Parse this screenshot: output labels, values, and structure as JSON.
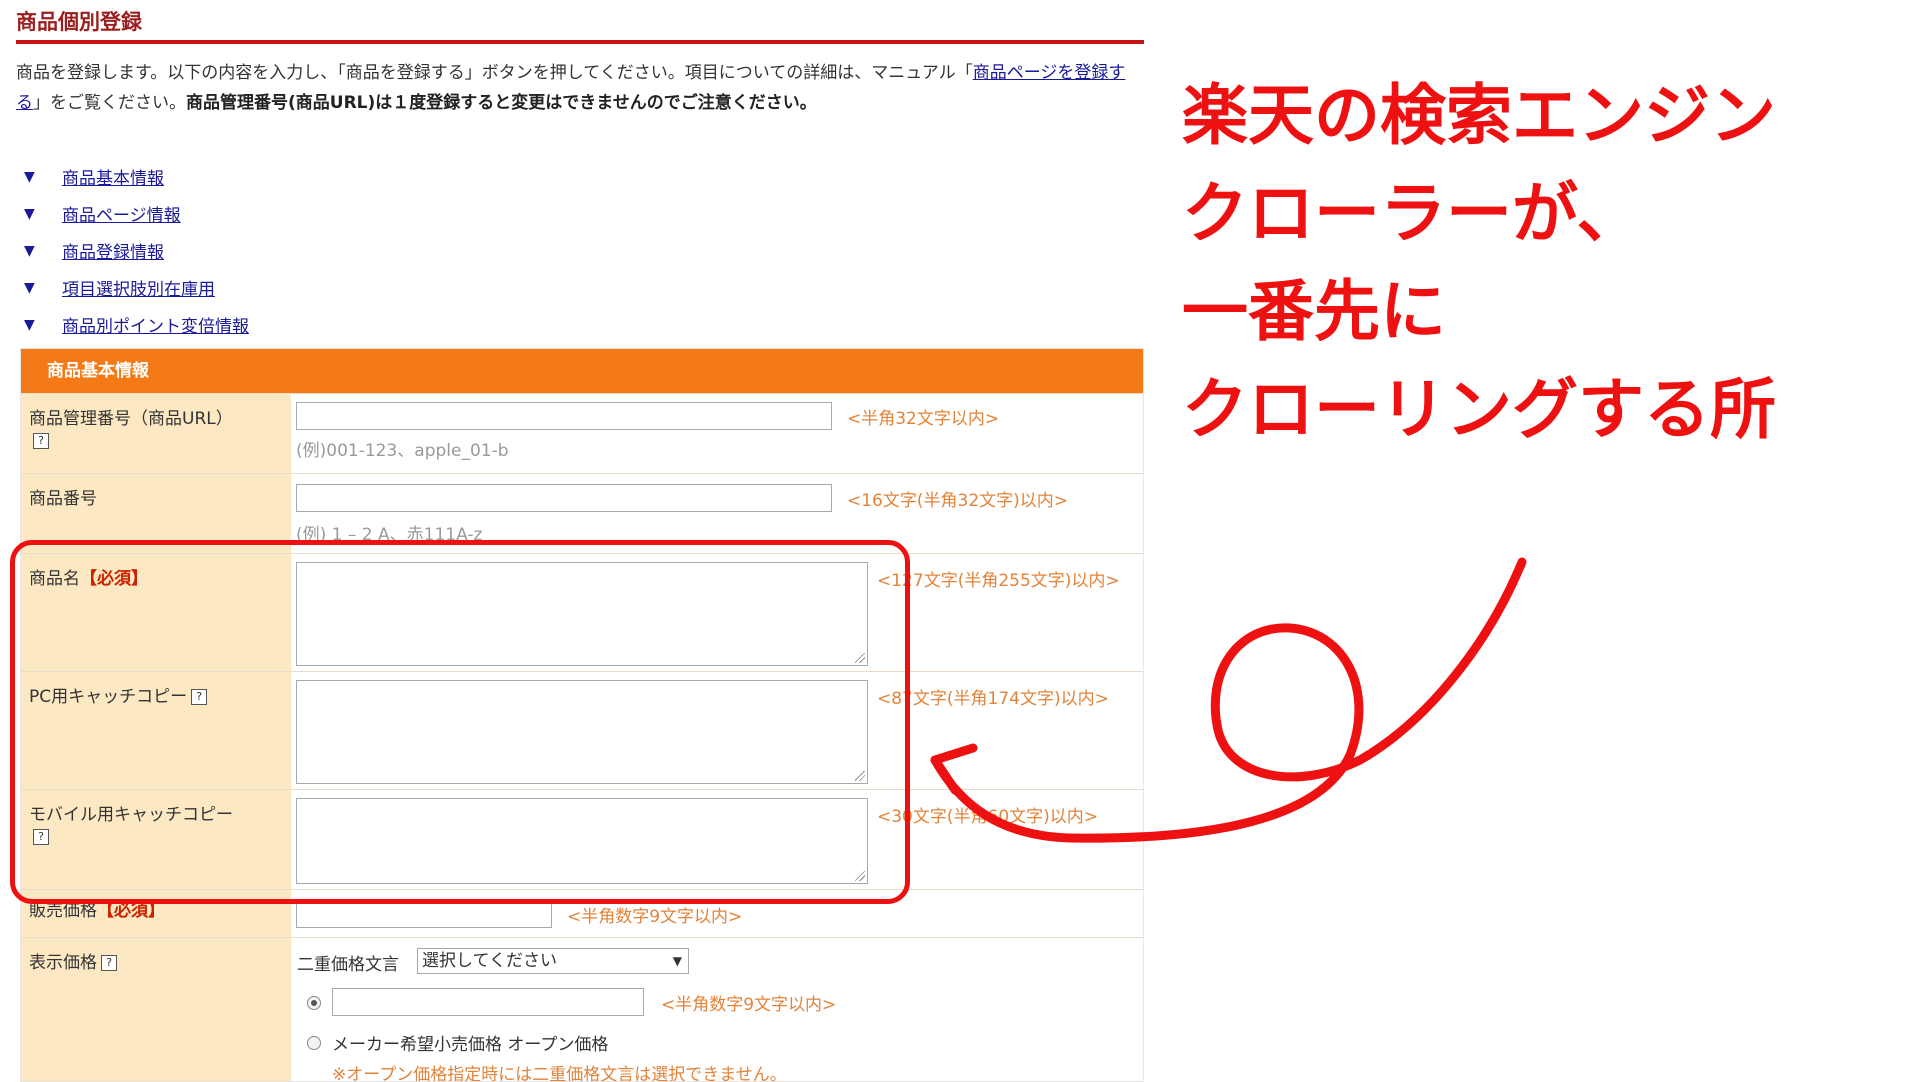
{
  "page": {
    "title": "商品個別登録",
    "intro": {
      "part1": "商品を登録します。以下の内容を入力し、「商品を登録する」ボタンを押してください。項目についての詳細は、マニュアル「",
      "link": "商品ページを登録する",
      "part2": "」をご覧ください。",
      "bold": "商品管理番号(商品URL)は１度登録すると変更はできませんのでご注意ください。"
    }
  },
  "anchors": [
    {
      "icon": "▼",
      "label": "商品基本情報"
    },
    {
      "icon": "▼",
      "label": "商品ページ情報"
    },
    {
      "icon": "▼",
      "label": "商品登録情報"
    },
    {
      "icon": "▼",
      "label": "項目選択肢別在庫用"
    },
    {
      "icon": "▼",
      "label": "商品別ポイント変倍情報"
    }
  ],
  "form": {
    "section_title": "商品基本情報",
    "help_glyph": "?",
    "fields": {
      "manage_no": {
        "label": "商品管理番号（商品URL）",
        "hint": "<半角32文字以内>",
        "example": "(例)001-123、apple_01-b"
      },
      "item_no": {
        "label": "商品番号",
        "hint": "<16文字(半角32文字)以内>",
        "example": "(例) 1 – 2 A、赤111A-z"
      },
      "item_name": {
        "label": "商品名",
        "required": "【必須】",
        "hint": "<127文字(半角255文字)以内>"
      },
      "pc_catch": {
        "label": "PC用キャッチコピー",
        "hint": "<87文字(半角174文字)以内>"
      },
      "mobile_catch": {
        "label": "モバイル用キャッチコピー",
        "hint": "<30文字(半角60文字)以内>"
      },
      "price": {
        "label": "販売価格",
        "required": "【必須】",
        "hint": "<半角数字9文字以内>"
      },
      "display_price": {
        "label": "表示価格",
        "double_label": "二重価格文言",
        "select_value": "選択してください",
        "hint": "<半角数字9文字以内>",
        "open_price": "メーカー希望小売価格 オープン価格",
        "note": "※オープン価格指定時には二重価格文言は選択できません。"
      }
    }
  },
  "annotation": {
    "lines": [
      "楽天の検索エンジン",
      "クローラーが、",
      "一番先に",
      "クローリングする所"
    ],
    "color": "#ee1111"
  }
}
